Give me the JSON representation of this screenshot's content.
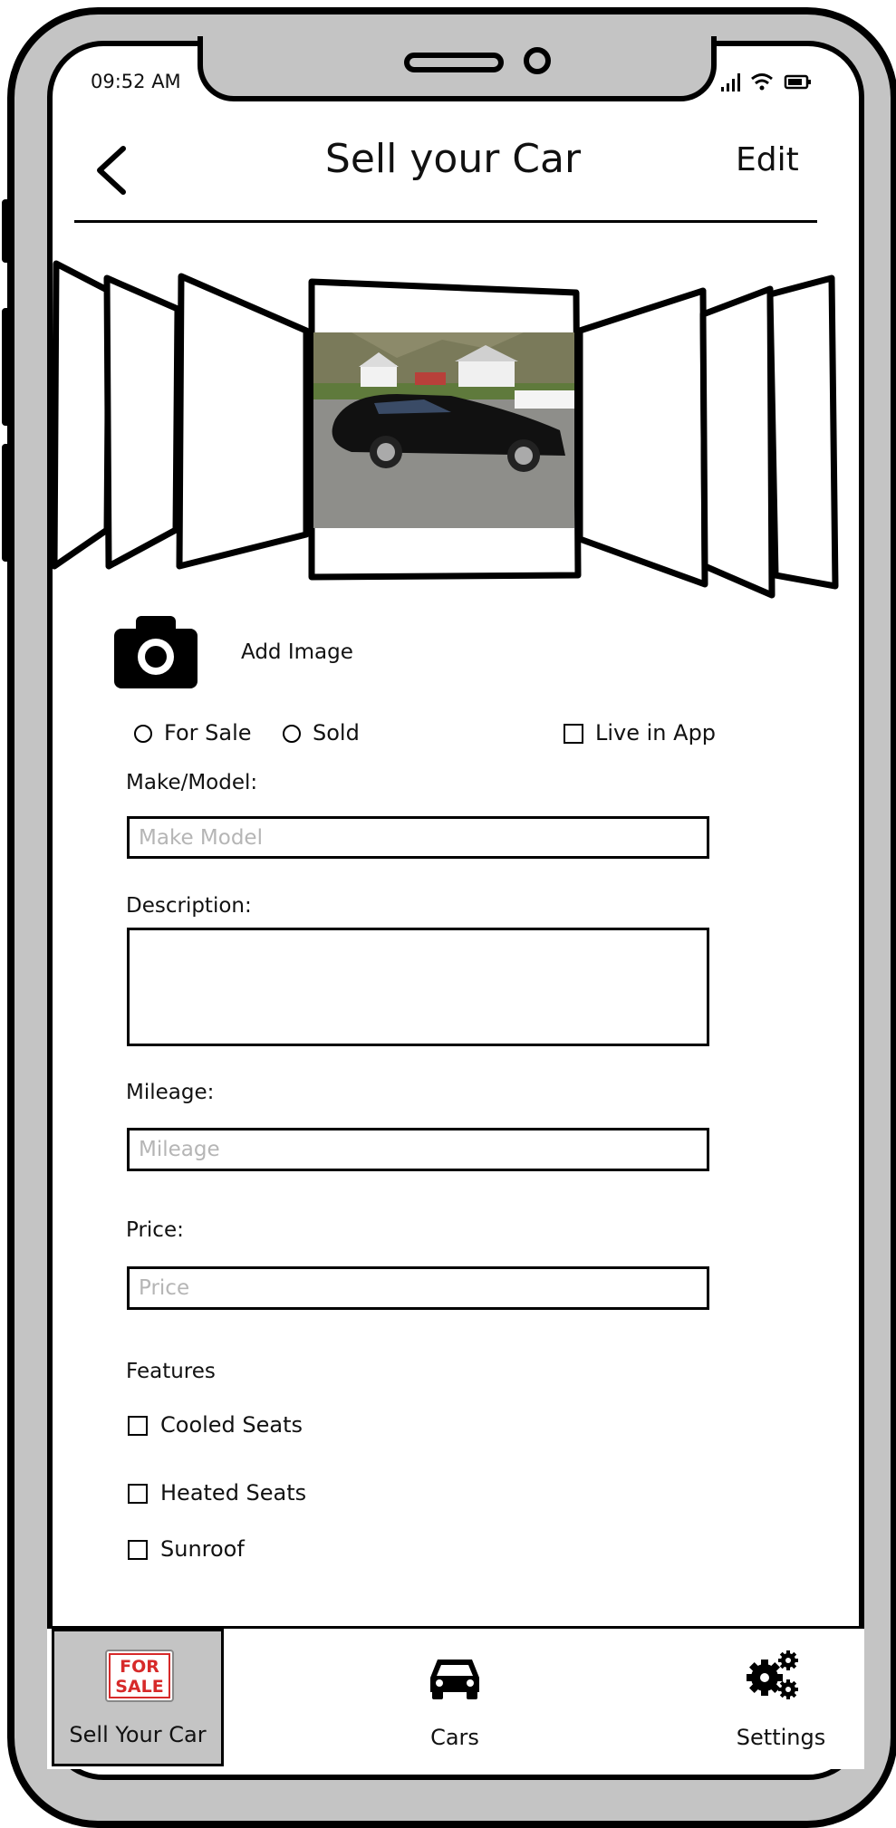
{
  "status_bar": {
    "time": "09:52 AM"
  },
  "header": {
    "title": "Sell your Car",
    "edit_label": "Edit"
  },
  "add_image": {
    "label": "Add Image"
  },
  "status_options": {
    "for_sale": "For Sale",
    "sold": "Sold",
    "live_in_app": "Live in App"
  },
  "form": {
    "make_model_label": "Make/Model:",
    "make_model_placeholder": "Make Model",
    "description_label": "Description:",
    "mileage_label": "Mileage:",
    "mileage_placeholder": "Mileage",
    "price_label": "Price:",
    "price_placeholder": "Price"
  },
  "features": {
    "title": "Features",
    "items": [
      "Cooled Seats",
      "Heated Seats",
      "Sunroof"
    ]
  },
  "tabbar": {
    "sell": {
      "label": "Sell Your Car",
      "badge_line1": "FOR",
      "badge_line2": "SALE"
    },
    "cars": {
      "label": "Cars"
    },
    "settings": {
      "label": "Settings"
    }
  },
  "colors": {
    "frame_gray": "#c4c4c4",
    "badge_red": "#d72a2a",
    "placeholder": "#b5b5b5"
  }
}
